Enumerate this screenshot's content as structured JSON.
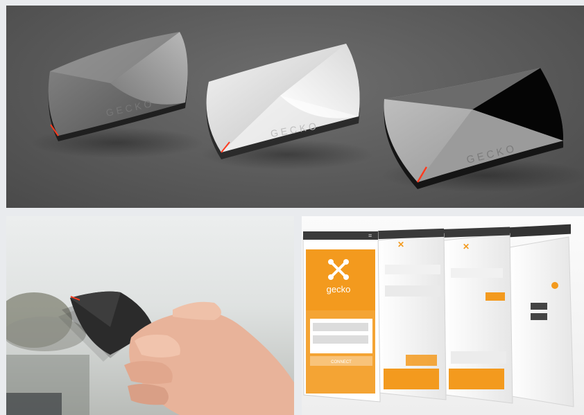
{
  "product": {
    "device_engraving": "GECKO",
    "app_name": "gecko",
    "app_button_label": "CONNECT",
    "accent_color": "#f39a1e",
    "indicator_color": "#ff3b1f"
  },
  "icons": [
    "gecko-logo-icon",
    "menu-icon"
  ]
}
